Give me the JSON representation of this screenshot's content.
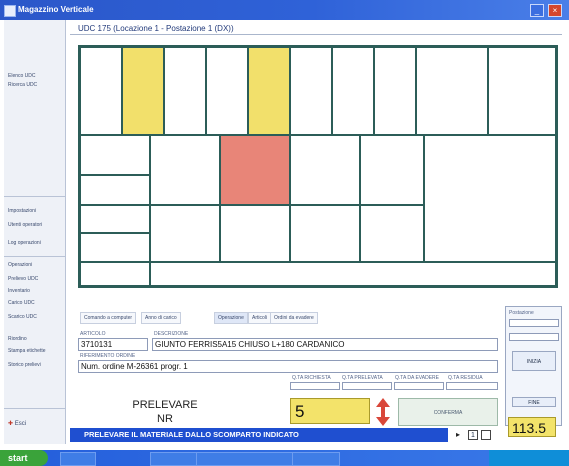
{
  "window": {
    "title": "Magazzino Verticale"
  },
  "header": {
    "title": "UDC 175 (Locazione 1 - Postazione 1 (DX))"
  },
  "sidebar": {
    "items": [
      "Elenco UDC",
      "Ricerca UDC",
      "Impostazioni",
      "Utenti operatori",
      "Log operazioni",
      "Operazioni",
      "Prelievo UDC",
      "Inventario",
      "Carico UDC",
      "Scarico UDC",
      "Riordino",
      "Stampa etichette",
      "Storico prelievi"
    ],
    "exit_label": "Esci"
  },
  "tabs": [
    "Comando a computer",
    "Anno di carico",
    "Operazione",
    "Articoli",
    "Ordini da evadere"
  ],
  "form": {
    "article_label": "ARTICOLO",
    "article_code": "3710131",
    "description_label": "DESCRIZIONE",
    "description": "GIUNTO FERRIS5A15 CHIUSO L+180   CARDANICO",
    "order_label": "RIFERIMENTO ORDINE",
    "order": "Num. ordine M-26361 progr. 1",
    "qty_labels": [
      "Q.TA RICHIESTA",
      "Q.TA PRELEVATA",
      "Q.TA DA EVADERE",
      "Q.TA RESIDUA"
    ]
  },
  "action": {
    "line1": "PRELEVARE",
    "line2": "NR",
    "quantity": "5",
    "confirm_label": "CONFERMA",
    "counter": "113.5"
  },
  "right_panel": {
    "title": "Postazione",
    "buttons": [
      "INIZIA",
      "FINE"
    ]
  },
  "status": {
    "message": "PRELEVARE IL MATERIALE DALLO SCOMPARTO INDICATO",
    "page": "1"
  },
  "taskbar": {
    "start_label": "start"
  },
  "colors": {
    "cell_yellow": "#F2E06B",
    "cell_red": "#E88578",
    "grid_line": "#2C5D58",
    "status_blue": "#1F4FD0"
  }
}
